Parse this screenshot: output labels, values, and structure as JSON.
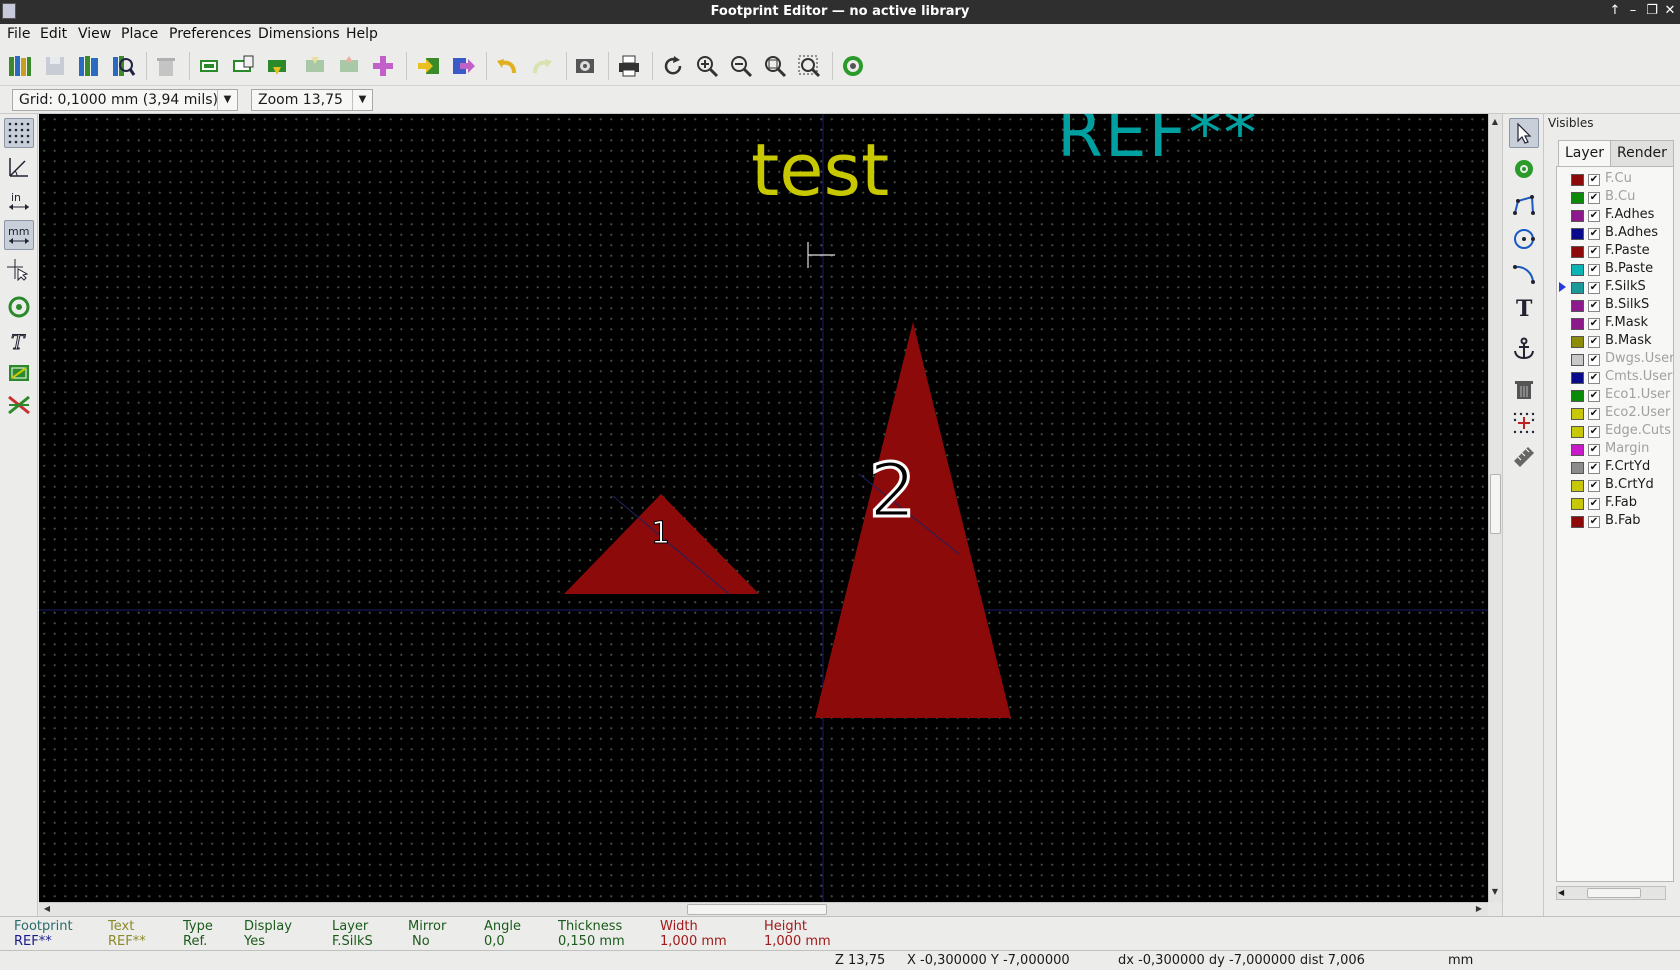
{
  "window": {
    "title": "Footprint Editor — no active library"
  },
  "menu": [
    "File",
    "Edit",
    "View",
    "Place",
    "Preferences",
    "Dimensions",
    "Help"
  ],
  "aux": {
    "grid": "Grid: 0,1000 mm (3,94 mils)",
    "zoom": "Zoom 13,75"
  },
  "canvas": {
    "ref_text": "REF**",
    "value_text": "test",
    "pad1_label": "1",
    "pad2_label": "2",
    "colors": {
      "ref": "#00a0a0",
      "value": "#c8c800",
      "pad": "#8c0a0a"
    }
  },
  "visibles": {
    "title": "Visibles",
    "tabs": [
      "Layer",
      "Render"
    ],
    "layers": [
      {
        "name": "F.Cu",
        "color": "#8c0a0a",
        "dim": true
      },
      {
        "name": "B.Cu",
        "color": "#0a8c0a",
        "dim": true
      },
      {
        "name": "F.Adhes",
        "color": "#8c1a8c",
        "dim": false
      },
      {
        "name": "B.Adhes",
        "color": "#0a0a8c",
        "dim": false
      },
      {
        "name": "F.Paste",
        "color": "#8c0a0a",
        "dim": false
      },
      {
        "name": "B.Paste",
        "color": "#0ab4b4",
        "dim": false
      },
      {
        "name": "F.SilkS",
        "color": "#1a9a9a",
        "dim": false,
        "active": true
      },
      {
        "name": "B.SilkS",
        "color": "#8c1a8c",
        "dim": false
      },
      {
        "name": "F.Mask",
        "color": "#8c1a8c",
        "dim": false
      },
      {
        "name": "B.Mask",
        "color": "#8c8c0a",
        "dim": false
      },
      {
        "name": "Dwgs.User",
        "color": "#c8c8c8",
        "dim": true
      },
      {
        "name": "Cmts.User",
        "color": "#0a0a8c",
        "dim": true
      },
      {
        "name": "Eco1.User",
        "color": "#0a8c0a",
        "dim": true
      },
      {
        "name": "Eco2.User",
        "color": "#c8c80a",
        "dim": true
      },
      {
        "name": "Edge.Cuts",
        "color": "#c8c80a",
        "dim": true
      },
      {
        "name": "Margin",
        "color": "#c81ac8",
        "dim": true
      },
      {
        "name": "F.CrtYd",
        "color": "#8c8c8c",
        "dim": false
      },
      {
        "name": "B.CrtYd",
        "color": "#c8c80a",
        "dim": false
      },
      {
        "name": "F.Fab",
        "color": "#c8c80a",
        "dim": false
      },
      {
        "name": "B.Fab",
        "color": "#8c0a0a",
        "dim": false
      }
    ]
  },
  "msgpanel": {
    "footprint": {
      "label": "Footprint",
      "value": "REF**"
    },
    "text": {
      "label": "Text",
      "value": "REF**"
    },
    "type": {
      "label": "Type",
      "value": "Ref."
    },
    "display": {
      "label": "Display",
      "value": "Yes"
    },
    "layer": {
      "label": "Layer",
      "value": "F.SilkS"
    },
    "mirror": {
      "label": "Mirror",
      "value": "No"
    },
    "angle": {
      "label": "Angle",
      "value": "0,0"
    },
    "thickness": {
      "label": "Thickness",
      "value": "0,150 mm"
    },
    "width": {
      "label": "Width",
      "value": "1,000 mm"
    },
    "height": {
      "label": "Height",
      "value": "1,000 mm"
    }
  },
  "status": {
    "zoom": "Z 13,75",
    "xy": "X -0,300000  Y -7,000000",
    "delta": "dx -0,300000  dy -7,000000  dist 7,006",
    "units": "mm"
  }
}
